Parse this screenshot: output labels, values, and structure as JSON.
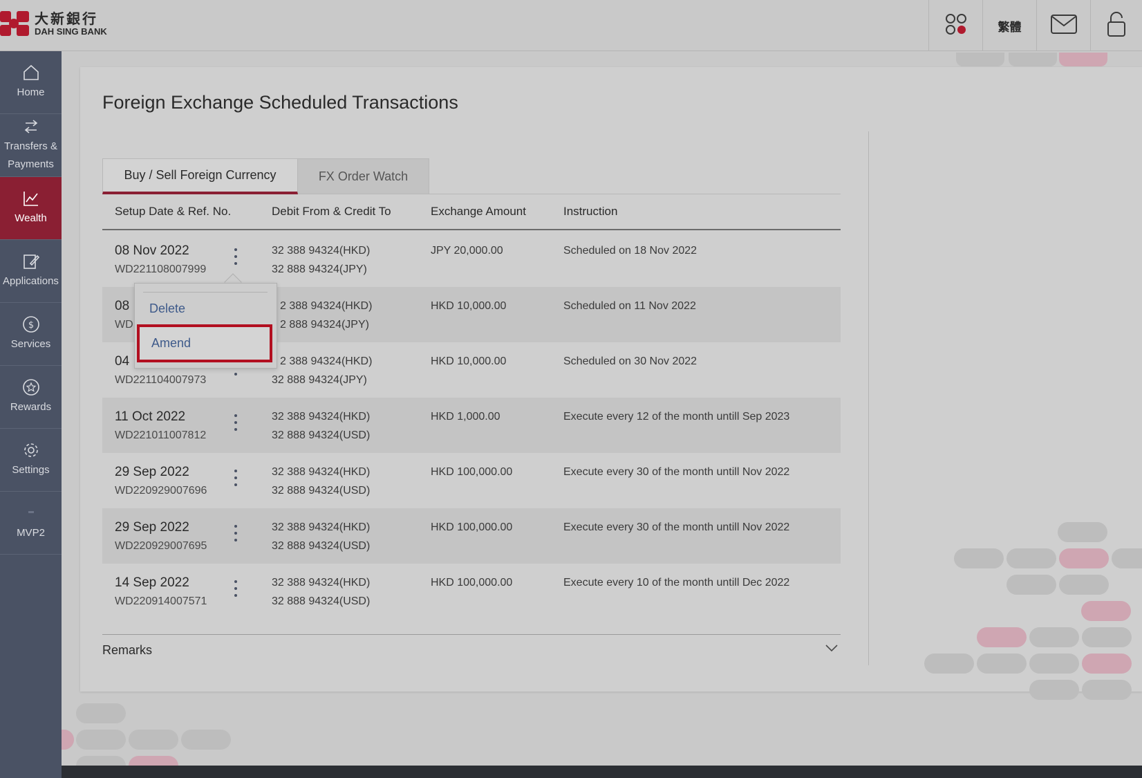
{
  "brand": {
    "name_cn": "大新銀行",
    "name_en": "DAH SING BANK"
  },
  "header": {
    "language_label": "繁體"
  },
  "sidebar": {
    "items": [
      {
        "label_line1": "Home",
        "label_line2": ""
      },
      {
        "label_line1": "Transfers &",
        "label_line2": "Payments"
      },
      {
        "label_line1": "Wealth",
        "label_line2": ""
      },
      {
        "label_line1": "Applications",
        "label_line2": ""
      },
      {
        "label_line1": "Services",
        "label_line2": ""
      },
      {
        "label_line1": "Rewards",
        "label_line2": ""
      },
      {
        "label_line1": "Settings",
        "label_line2": ""
      },
      {
        "label_line1": "MVP2",
        "label_line2": ""
      }
    ],
    "active": "Wealth"
  },
  "page": {
    "title": "Foreign Exchange Scheduled Transactions",
    "tabs": [
      {
        "label": "Buy / Sell Foreign Currency",
        "active": true
      },
      {
        "label": "FX Order Watch",
        "active": false
      }
    ],
    "columns": [
      "Setup Date & Ref. No.",
      "Debit From & Credit To",
      "Exchange Amount",
      "Instruction"
    ],
    "rows": [
      {
        "date": "08 Nov 2022",
        "ref": "WD221108007999",
        "debit": "32 388 94324(HKD)",
        "credit": "32 888 94324(JPY)",
        "amount": "JPY 20,000.00",
        "instruction": "Scheduled on 18 Nov 2022"
      },
      {
        "date": "08",
        "ref": "WD",
        "debit": "2 388 94324(HKD)",
        "credit": "2 888 94324(JPY)",
        "amount": "HKD 10,000.00",
        "instruction": "Scheduled on 11 Nov 2022"
      },
      {
        "date": "04",
        "ref": "WD221104007973",
        "debit": "2 388 94324(HKD)",
        "credit": "32 888 94324(JPY)",
        "amount": "HKD 10,000.00",
        "instruction": "Scheduled on 30 Nov 2022"
      },
      {
        "date": "11 Oct 2022",
        "ref": "WD221011007812",
        "debit": "32 388 94324(HKD)",
        "credit": "32 888 94324(USD)",
        "amount": "HKD 1,000.00",
        "instruction": "Execute every 12 of the month untill Sep 2023"
      },
      {
        "date": "29 Sep 2022",
        "ref": "WD220929007696",
        "debit": "32 388 94324(HKD)",
        "credit": "32 888 94324(USD)",
        "amount": "HKD 100,000.00",
        "instruction": "Execute every 30 of the month untill Nov 2022"
      },
      {
        "date": "29 Sep 2022",
        "ref": "WD220929007695",
        "debit": "32 388 94324(HKD)",
        "credit": "32 888 94324(USD)",
        "amount": "HKD 100,000.00",
        "instruction": "Execute every 30 of the month untill Nov 2022"
      },
      {
        "date": "14 Sep 2022",
        "ref": "WD220914007571",
        "debit": "32 388 94324(HKD)",
        "credit": "32 888 94324(USD)",
        "amount": "HKD 100,000.00",
        "instruction": "Execute every 10 of the month untill Dec 2022"
      }
    ],
    "remarks_label": "Remarks"
  },
  "context_menu": {
    "delete_label": "Delete",
    "amend_label": "Amend",
    "highlighted": "Amend"
  },
  "colors": {
    "accent": "#8a1f33",
    "sidebar": "#4a5264",
    "highlight_border": "#b20f20",
    "link": "#3e5a8a"
  }
}
